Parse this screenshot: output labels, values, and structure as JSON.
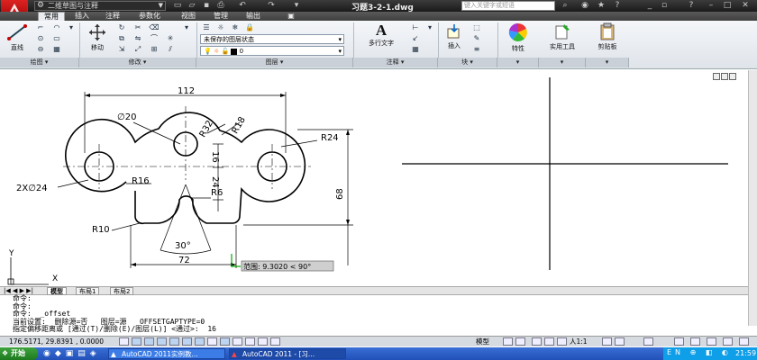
{
  "titlebar": {
    "workspace": "二维草图与注释",
    "doc_title": "习题3-2-1.dwg",
    "search_placeholder": "键入关键字或短语"
  },
  "tabs": [
    "常用",
    "插入",
    "注释",
    "参数化",
    "视图",
    "管理",
    "输出"
  ],
  "ribbon": {
    "draw_line_label": "直线",
    "move_label": "移动",
    "multiline_text_label": "多行文字",
    "insert_label": "插入",
    "properties_label": "特性",
    "utilities_label": "实用工具",
    "clipboard_label": "剪贴板",
    "layer_state": "未保存的图层状态",
    "layer_current": "0",
    "panels": [
      "绘图",
      "修改",
      "图层",
      "注释",
      "块"
    ]
  },
  "drawing": {
    "dims": {
      "overall_width": "112",
      "dia20": "∅20",
      "r32": "R32",
      "r18": "R18",
      "r24": "R24",
      "d16": "16",
      "d24": "24",
      "hole_note": "2X∅24",
      "r16": "R16",
      "r6": "R6",
      "height68": "68",
      "r10": "R10",
      "angle": "30°",
      "base72": "72"
    },
    "tooltip": "范围: 9.3020 < 90°",
    "ucs_y": "Y",
    "ucs_x": "X"
  },
  "layout_tabs": [
    "模型",
    "布局1",
    "布局2"
  ],
  "command_lines": [
    "命令:",
    "命令:",
    "命令:  _offset",
    "当前设置:  删除源=否   图层=源   OFFSETGAPTYPE=0",
    "指定偏移距离或 [通过(T)/删除(E)/图层(L)] <通过>:  16"
  ],
  "statusbar": {
    "coords": "176.5171, 29.8391 , 0.0000",
    "model_label": "模型",
    "scale": "人1:1"
  },
  "taskbar": {
    "start": "开始",
    "tasks": [
      "AutoCAD 2011实例教...",
      "AutoCAD 2011 - [习..."
    ],
    "clock": "21:59"
  }
}
